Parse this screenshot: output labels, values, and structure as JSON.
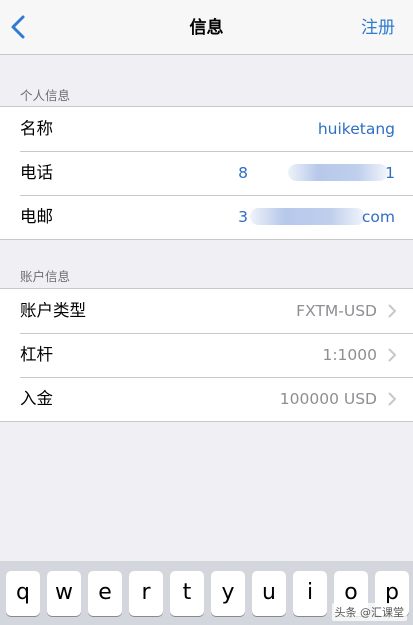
{
  "nav": {
    "title": "信息",
    "action": "注册"
  },
  "personal": {
    "header": "个人信息",
    "rows": [
      {
        "label": "名称",
        "value": "huiketang"
      },
      {
        "label": "电话",
        "value_start": "8",
        "value_end": "1"
      },
      {
        "label": "电邮",
        "value_start": "3",
        "value_end": "com"
      }
    ]
  },
  "account": {
    "header": "账户信息",
    "rows": [
      {
        "label": "账户类型",
        "value": "FXTM-USD"
      },
      {
        "label": "杠杆",
        "value": "1:1000"
      },
      {
        "label": "入金",
        "value": "100000 USD"
      }
    ]
  },
  "keyboard": {
    "keys": [
      "q",
      "w",
      "e",
      "r",
      "t",
      "y",
      "u",
      "i",
      "o",
      "p"
    ]
  },
  "watermark": "头条 @汇课堂",
  "colors": {
    "accent": "#2f7bd1",
    "value": "#2f6fc2",
    "secondary": "#8e8e93"
  }
}
